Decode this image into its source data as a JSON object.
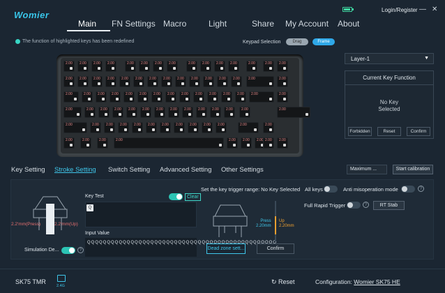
{
  "app": {
    "logo": "Womier"
  },
  "nav": {
    "tabs": [
      {
        "label": "Main"
      },
      {
        "label": "FN Settings"
      },
      {
        "label": "Macro"
      },
      {
        "label": "Light"
      },
      {
        "label": "Share"
      },
      {
        "label": "My Account"
      },
      {
        "label": "About"
      }
    ],
    "login": "Login/Register",
    "win_min": "—",
    "win_close": "✕"
  },
  "notice": "The function of highlighted keys has been redefined",
  "keypad": {
    "label": "Keypad Selection",
    "drag": "Drag",
    "frame": "Frame"
  },
  "layer": {
    "selected": "Layer-1",
    "arrow": "▼"
  },
  "current_key": {
    "title": "Current Key Function",
    "line1": "No Key",
    "line2": "Selected",
    "forbidden": "Forbidden",
    "reset": "Reset",
    "confirm": "Confirm"
  },
  "subtabs": [
    {
      "label": "Key Setting"
    },
    {
      "label": "Stroke Setting"
    },
    {
      "label": "Switch Setting"
    },
    {
      "label": "Advanced Setting"
    },
    {
      "label": "Other Settings"
    }
  ],
  "maximum": "Maximum ...",
  "calibration": "Start calibration",
  "stroke": {
    "key_test": "Key Test",
    "clear": "Clear",
    "q_key": "Q",
    "input_value_label": "Input Value",
    "input_value": "QQQQQQQQQQQQQQQQQQQQQQQQQQQQQQQQQQQQQQQQQQQQQQQQ",
    "press_mm": "2.2'mm(Press)",
    "up_mm": "2.2'mm(Up)",
    "simulation": "Simulation De...",
    "trigger_range": "Set the key trigger range: No Key Selected",
    "all_keys": "All keys",
    "anti_mis": "Anti misoperation mode",
    "full_rapid": "Full Rapid Trigger",
    "rt_stab": "RT Stab",
    "press_label": "Press",
    "press_value": "2.20mm",
    "up_label": "Up",
    "up_value": "2.20mm",
    "dead_zone": "Dead zone sett...",
    "confirm": "Confirm",
    "help": "?"
  },
  "footer": {
    "model": "SK75 TMR",
    "conn": "2.4G",
    "reset": "Reset",
    "config_label": "Configuration:",
    "config_value": "Womier SK75 HE"
  },
  "key_label": "2.00",
  "colors": {
    "accent": "#38c4e8",
    "toggle_on": "#2cc4b4",
    "press_color": "#e87070",
    "up_color": "#f0a030"
  }
}
